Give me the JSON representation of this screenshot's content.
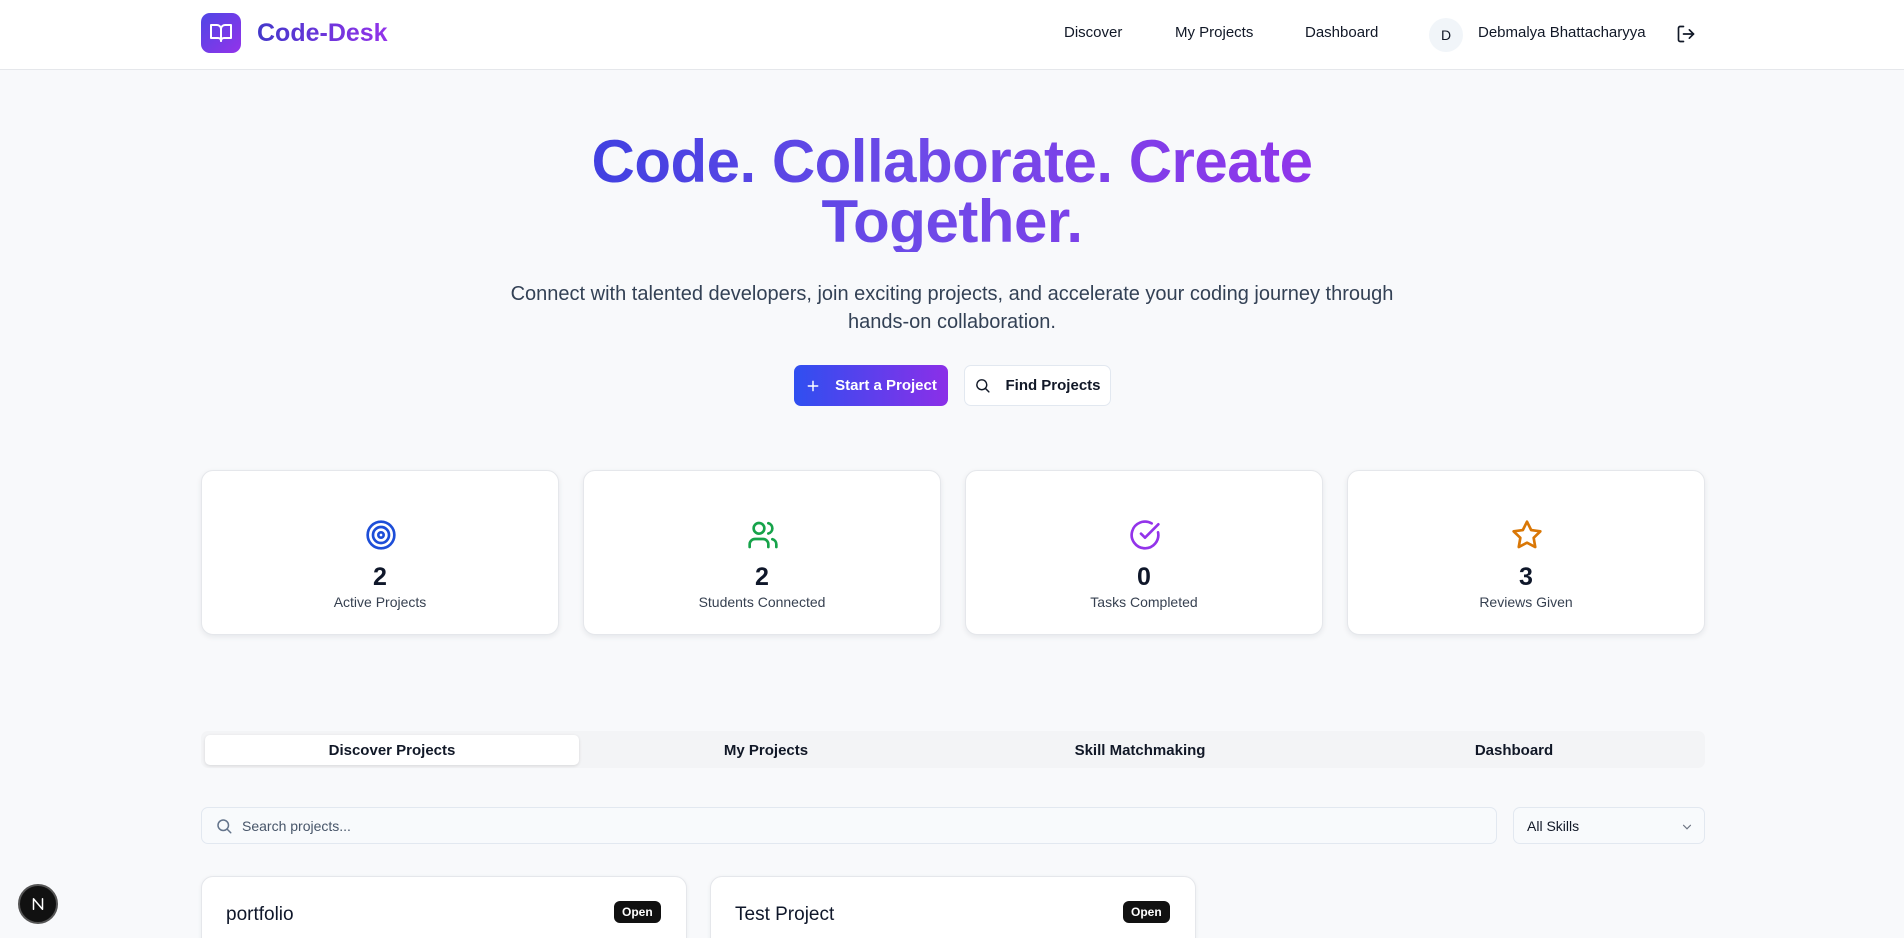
{
  "header": {
    "brand_name": "Code-Desk",
    "nav": [
      "Discover",
      "My Projects",
      "Dashboard"
    ],
    "user_initial": "D",
    "user_name": "Debmalya Bhattacharyya"
  },
  "hero": {
    "title": "Code. Collaborate. Create Together.",
    "subtitle": "Connect with talented developers, join exciting projects, and accelerate your coding journey through hands-on collaboration.",
    "primary_button": "Start a Project",
    "secondary_button": "Find Projects"
  },
  "stats": [
    {
      "value": "2",
      "label": "Active Projects",
      "icon": "target-icon",
      "color": "#1d4ed8"
    },
    {
      "value": "2",
      "label": "Students Connected",
      "icon": "users-icon",
      "color": "#16a34a"
    },
    {
      "value": "0",
      "label": "Tasks Completed",
      "icon": "check-circle-icon",
      "color": "#9333ea"
    },
    {
      "value": "3",
      "label": "Reviews Given",
      "icon": "star-icon",
      "color": "#d97706"
    }
  ],
  "tabs": [
    "Discover Projects",
    "My Projects",
    "Skill Matchmaking",
    "Dashboard"
  ],
  "active_tab": "Discover Projects",
  "search": {
    "placeholder": "Search projects..."
  },
  "skill_filter": {
    "value": "All Skills"
  },
  "projects": [
    {
      "title": "portfolio",
      "status": "Open"
    },
    {
      "title": "Test Project",
      "status": "Open"
    }
  ],
  "colors": {
    "brand_gradient_start": "#4f46e5",
    "brand_gradient_end": "#9333ea"
  }
}
